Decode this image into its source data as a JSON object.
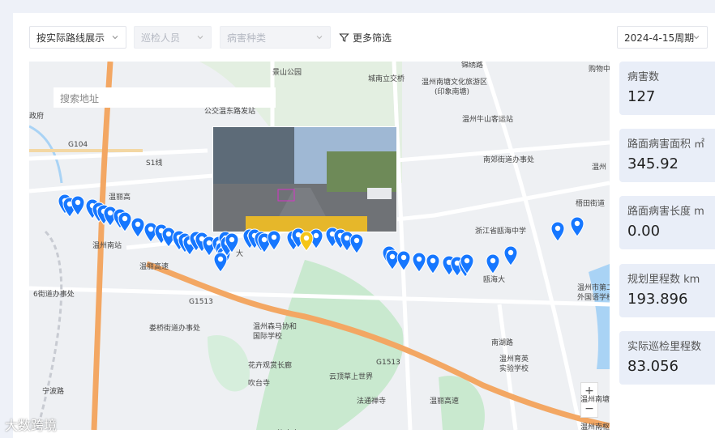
{
  "filters": {
    "route_mode": "按实际路线展示",
    "inspector_placeholder": "巡检人员",
    "disease_type_placeholder": "病害种类",
    "more_filters": "更多筛选",
    "date_period": "2024-4-15周期"
  },
  "map": {
    "search_placeholder": "搜索地址",
    "zoom_in": "+",
    "zoom_out": "−",
    "labels": [
      "锦绣路",
      "景山公园",
      "城南立交桥",
      "温州南塘文化旅游区",
      "(印象南塘)",
      "购物中",
      "公交温东路发站",
      "温州牛山客运站",
      "南郊街道办事处",
      "温州",
      "梧田街道",
      "政府",
      "G104",
      "S1线",
      "温丽高",
      "浙江省瓯海中学",
      "温州南站",
      "瓯海大",
      "大",
      "6街道办事处",
      "温丽高速",
      "G1513",
      "温州森马协和",
      "国际学校",
      "温州市第二",
      "外国语学校",
      "娄桥街道办事处",
      "南湖路",
      "温州育英",
      "实验学校",
      "花卉观赏长廊",
      "G1513",
      "吹台寺",
      "云顶草上世界",
      "温丽高速",
      "法通禅寺",
      "宁波路",
      "沁水亭",
      "温州南塘",
      "温州南枢纽"
    ],
    "marker_color": "#1677ff",
    "selected_marker_color": "#f5c518"
  },
  "stats": [
    {
      "label": "病害数",
      "value": "127"
    },
    {
      "label": "路面病害面积 ㎡",
      "value": "345.92"
    },
    {
      "label": "路面病害长度 m",
      "value": "0.00"
    },
    {
      "label": "规划里程数 km",
      "value": "193.896"
    },
    {
      "label": "实际巡检里程数",
      "value": "83.056"
    }
  ],
  "watermark": "大数跨境"
}
